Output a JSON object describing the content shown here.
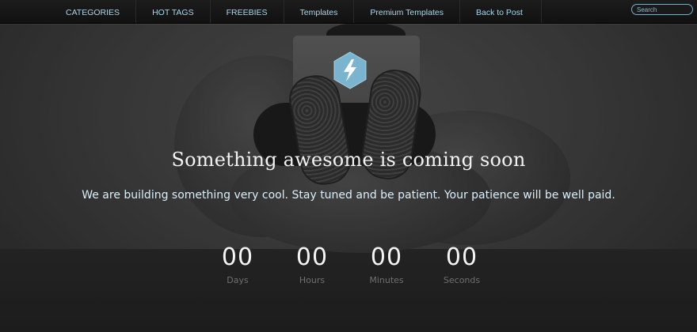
{
  "nav": {
    "items": [
      {
        "label": "CATEGORIES"
      },
      {
        "label": "HOT TAGS"
      },
      {
        "label": "FREEBIES"
      },
      {
        "label": "Templates"
      },
      {
        "label": "Premium Templates"
      },
      {
        "label": "Back to Post"
      }
    ],
    "search_placeholder": "Search"
  },
  "brand": {
    "icon": "lightning-bolt-icon",
    "hex_color": "#7ab4cf"
  },
  "hero": {
    "headline": "Something awesome is coming soon",
    "tagline": "We are building something very cool. Stay tuned and be patient. Your patience will be well paid."
  },
  "countdown": {
    "days": {
      "value": "00",
      "label": "Days"
    },
    "hours": {
      "value": "00",
      "label": "Hours"
    },
    "minutes": {
      "value": "00",
      "label": "Minutes"
    },
    "seconds": {
      "value": "00",
      "label": "Seconds"
    }
  },
  "colors": {
    "nav_text": "#a9d6ea",
    "accent": "#7ab4cf"
  }
}
